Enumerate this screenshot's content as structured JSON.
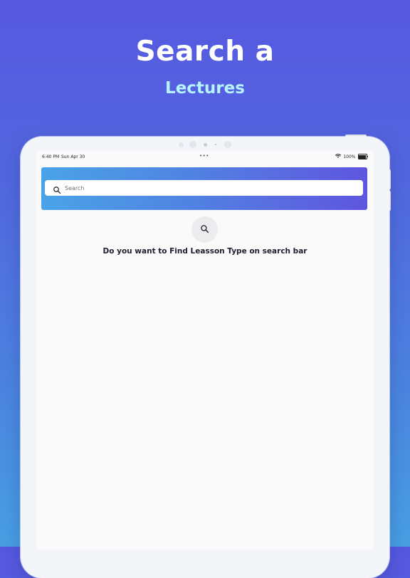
{
  "promo": {
    "headline": "Search a",
    "subheadline": "Lectures"
  },
  "status_bar": {
    "time": "6:40 PM",
    "date": "Sun Apr 30",
    "multitask_indicator": "•••",
    "battery_text": "100%",
    "wifi_icon": "wifi-icon",
    "battery_icon": "battery-icon"
  },
  "search": {
    "placeholder": "Search",
    "value": "",
    "icon": "search-icon"
  },
  "empty_state": {
    "icon": "search-icon",
    "message": "Do you want to Find Leasson Type on search bar"
  },
  "colors": {
    "background_top": "#5758e0",
    "background_bottom": "#48a0e4",
    "headline": "#ffffff",
    "subheadline": "#b6f3ff",
    "header_gradient_start": "#4aa3e8",
    "header_gradient_end": "#5e55df",
    "screen_background": "#fafafa",
    "empty_icon_circle": "#ececee",
    "message_text": "#1d1f2c"
  }
}
